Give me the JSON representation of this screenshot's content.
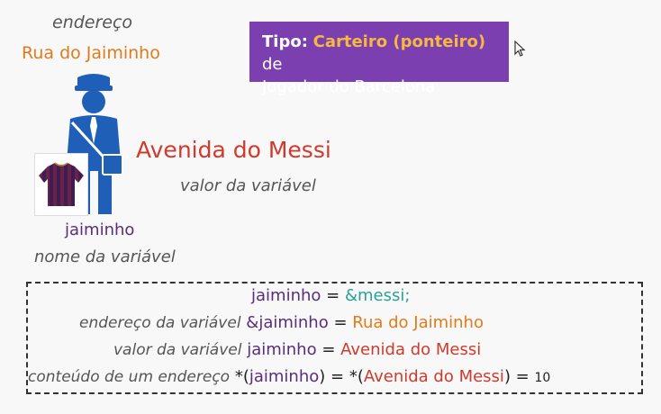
{
  "labels": {
    "endereco": "endereço",
    "rua": "Rua do Jaiminho",
    "avenida": "Avenida do Messi",
    "valor_variavel": "valor da variável",
    "jaiminho": "jaiminho",
    "nome_variavel": "nome da variável"
  },
  "tipo_box": {
    "prefix": "Tipo:",
    "highlight": "Carteiro (ponteiro)",
    "suffix": "de",
    "line2": "Jogador do Barcelona"
  },
  "code": {
    "line1": {
      "var": "jaiminho",
      "eq": " = ",
      "value": "&messi;"
    },
    "line2": {
      "label": "endereço da variável",
      "var": "&jaiminho",
      "eq": " = ",
      "value": "Rua do Jaiminho"
    },
    "line3": {
      "label": "valor da variável",
      "var": "jaiminho",
      "eq": " = ",
      "value": "Avenida do Messi"
    },
    "line4": {
      "label": "conteúdo de um endereço",
      "star1": "*(",
      "var": "jaiminho",
      "close1": ") = *(",
      "value": "Avenida do Messi",
      "close2": ") = ",
      "result": "10"
    }
  },
  "colors": {
    "purple_box": "#7b3fb0",
    "gold": "#f5b843",
    "orange": "#e07b1a",
    "red": "#d03a2c",
    "purple_text": "#5a2d7a",
    "teal": "#2aa198",
    "figure_blue": "#1f5fb8"
  },
  "icons": {
    "figure": "mail-carrier-icon",
    "jersey": "soccer-jersey-icon",
    "cursor": "mouse-cursor-icon"
  }
}
